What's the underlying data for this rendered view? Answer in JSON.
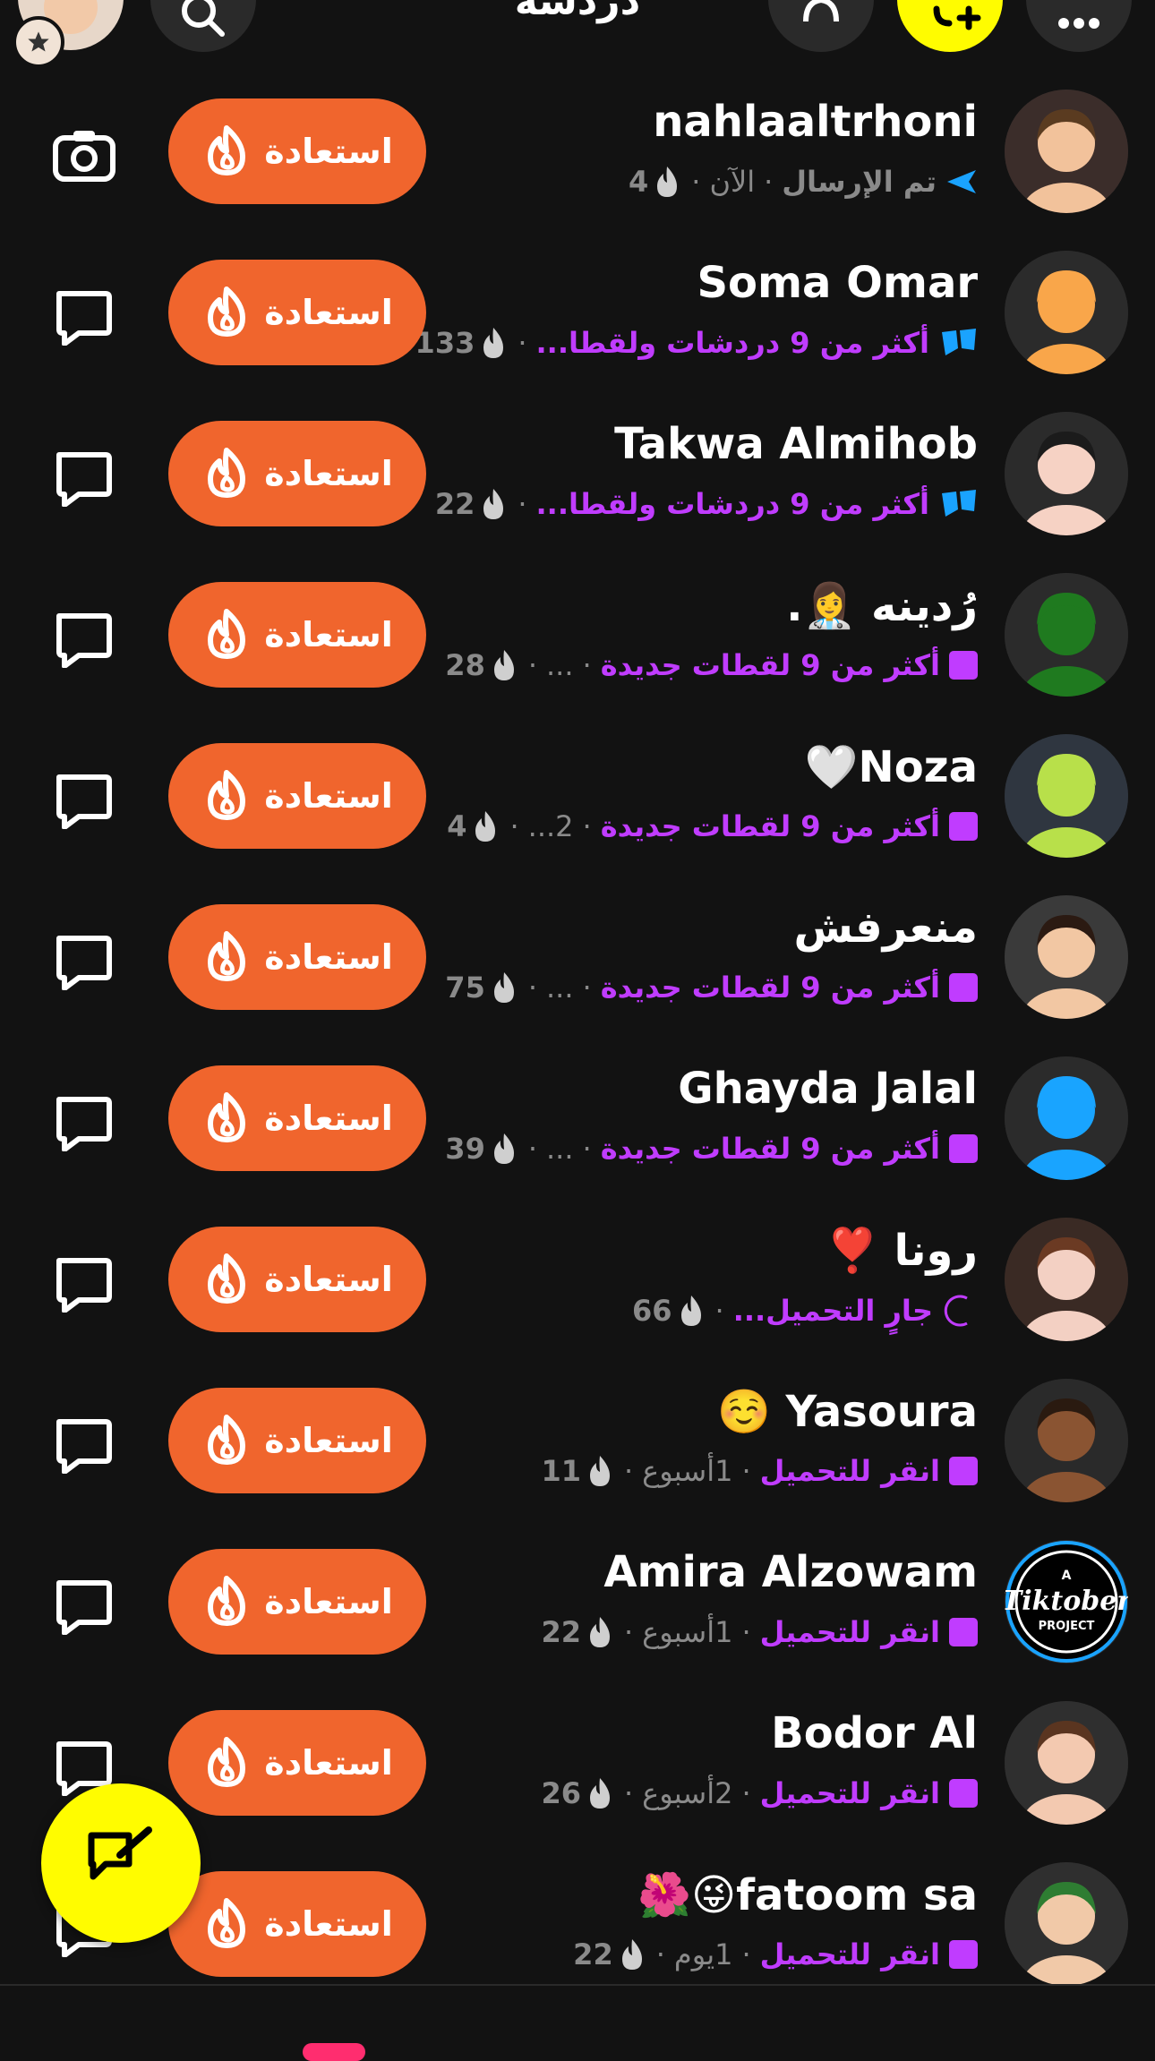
{
  "header": {
    "title": "دردشة",
    "new_chat_label": "+",
    "icons": [
      "profile-bitmoji",
      "search-icon",
      "bell-icon",
      "add-friend-icon",
      "more-icon"
    ]
  },
  "restore_label": "استعادة",
  "chats": [
    {
      "name": "nahlaaltrhoni",
      "status": "تم الإرسال",
      "status_color": "#8a8a8a",
      "time": "الآن",
      "streak": "4",
      "status_icon": "sent-arrow-icon",
      "icon_color": "#1aa3ff",
      "action": "camera-icon",
      "avatar_bg": "#3b2d2a",
      "skin": "#f2c29b",
      "hair": "#5a3b20"
    },
    {
      "name": "Soma Omar",
      "status": "أكثر من 9 دردشات ولقطا...",
      "status_color": "#c03cff",
      "time": "",
      "streak": "133",
      "status_icon": "chat-bubble-icon",
      "icon_color": "#1aa3ff",
      "action": "chat-icon",
      "avatar_bg": "#2b2b2b",
      "skin": "#f9a64a",
      "hair": "#f9a64a"
    },
    {
      "name": "Takwa Almihob",
      "status": "أكثر من 9 دردشات ولقطا...",
      "status_color": "#c03cff",
      "time": "",
      "streak": "22",
      "status_icon": "chat-bubble-icon",
      "icon_color": "#1aa3ff",
      "action": "chat-icon",
      "avatar_bg": "#2b2b2b",
      "skin": "#f6d2c4",
      "hair": "#1b1b1b"
    },
    {
      "name": "رُدينه 👩‍⚕️.",
      "status": "أكثر من 9 لقطات جديدة",
      "status_color": "#c03cff",
      "time": "...",
      "streak": "28",
      "status_icon": "snap-square-icon",
      "icon_color": "#c03cff",
      "action": "chat-icon",
      "avatar_bg": "#2b2b2b",
      "skin": "#1f7a1f",
      "hair": "#1f7a1f"
    },
    {
      "name": "Noza🤍",
      "status": "أكثر من 9 لقطات جديدة",
      "status_color": "#c03cff",
      "time": "2...",
      "streak": "4",
      "status_icon": "snap-square-icon",
      "icon_color": "#c03cff",
      "action": "chat-icon",
      "avatar_bg": "#2f3640",
      "skin": "#b8e04a",
      "hair": "#b8e04a"
    },
    {
      "name": "منعرفش",
      "status": "أكثر من 9 لقطات جديدة",
      "status_color": "#c03cff",
      "time": "...",
      "streak": "75",
      "status_icon": "snap-square-icon",
      "icon_color": "#c03cff",
      "action": "chat-icon",
      "avatar_bg": "#3a3a3a",
      "skin": "#f2c7a3",
      "hair": "#2b1a12"
    },
    {
      "name": "Ghayda Jalal",
      "status": "أكثر من 9 لقطات جديدة",
      "status_color": "#c03cff",
      "time": "...",
      "streak": "39",
      "status_icon": "snap-square-icon",
      "icon_color": "#c03cff",
      "action": "chat-icon",
      "avatar_bg": "#2b2b2b",
      "skin": "#19a4ff",
      "hair": "#19a4ff"
    },
    {
      "name": "رونا ❣️",
      "status": "جارٍ التحميل...",
      "status_color": "#c03cff",
      "time": "",
      "streak": "66",
      "status_icon": "loading-icon",
      "icon_color": "#c03cff",
      "action": "chat-icon",
      "avatar_bg": "#3a2a24",
      "skin": "#f3d0c3",
      "hair": "#6b3a23"
    },
    {
      "name": "Yasoura ☺️",
      "status": "انقر للتحميل",
      "status_color": "#c03cff",
      "time": "1أسبوع",
      "streak": "11",
      "status_icon": "snap-square-icon",
      "icon_color": "#c03cff",
      "action": "chat-icon",
      "avatar_bg": "#2a2a2a",
      "skin": "#8a5432",
      "hair": "#2a1a10"
    },
    {
      "name": "Amira Alzowam",
      "status": "انقر للتحميل",
      "status_color": "#c03cff",
      "time": "1أسبوع",
      "streak": "22",
      "status_icon": "snap-square-icon",
      "icon_color": "#c03cff",
      "action": "chat-icon",
      "avatar_bg": "#000000",
      "skin": "#000000",
      "hair": "#000000",
      "logo_text": "Tiktober",
      "logo_top": "A",
      "logo_bottom": "PROJECT"
    },
    {
      "name": "Bodor Al",
      "status": "انقر للتحميل",
      "status_color": "#c03cff",
      "time": "2أسبوع",
      "streak": "26",
      "status_icon": "snap-square-icon",
      "icon_color": "#c03cff",
      "action": "chat-icon",
      "avatar_bg": "#2f2f2f",
      "skin": "#f3c9b0",
      "hair": "#5a3520"
    },
    {
      "name": "fatoom sa😜🌺",
      "status": "انقر للتحميل",
      "status_color": "#c03cff",
      "time": "1يوم",
      "streak": "22",
      "status_icon": "snap-square-icon",
      "icon_color": "#c03cff",
      "action": "chat-icon",
      "avatar_bg": "#2f2f2f",
      "skin": "#f1c9a8",
      "hair": "#2e7d32"
    }
  ]
}
